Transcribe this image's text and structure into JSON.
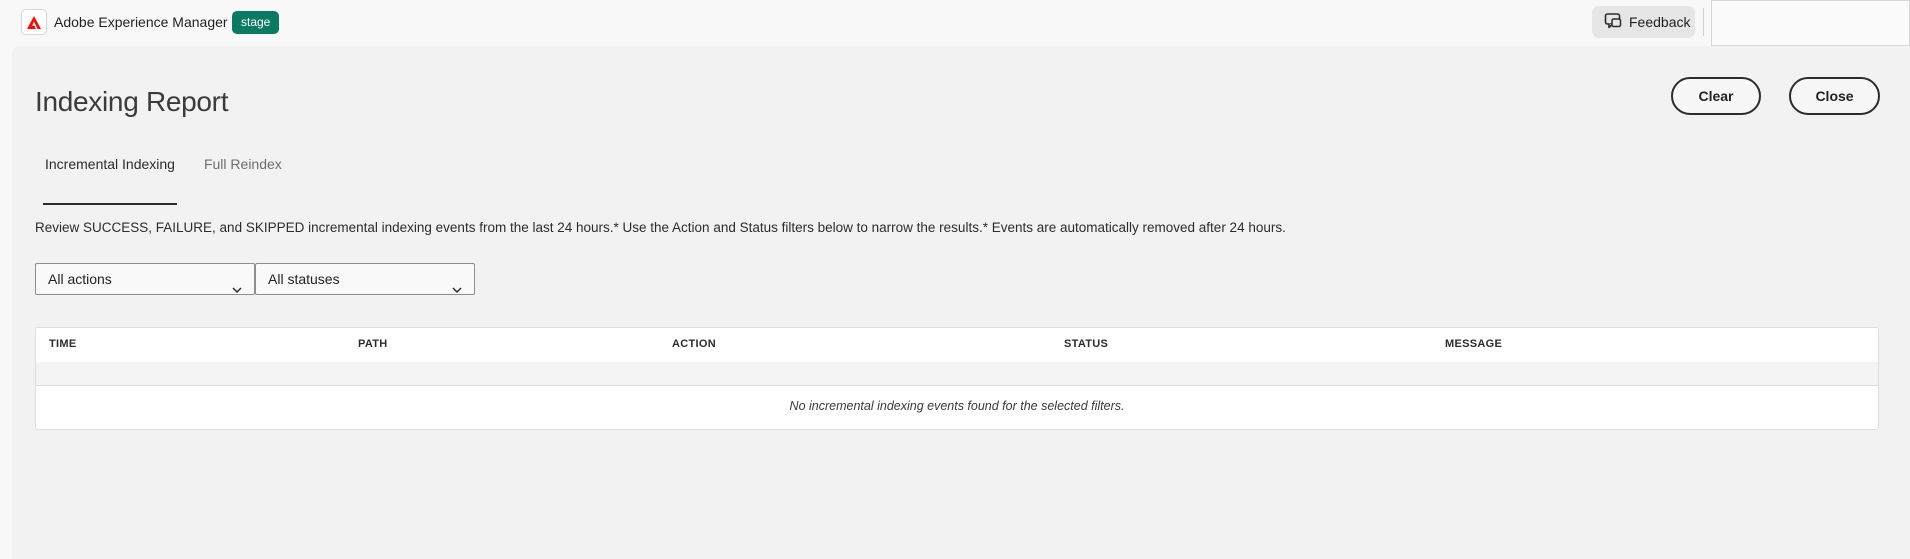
{
  "topbar": {
    "app_name": "Adobe Experience Manager",
    "env_badge": "stage",
    "feedback_label": "Feedback",
    "logo_icon": "adobe-logo-icon",
    "feedback_icon": "chat-bubble-icon",
    "brand_color": "#eb1000",
    "badge_color": "#0b7a63"
  },
  "page": {
    "title": "Indexing Report",
    "clear_label": "Clear",
    "close_label": "Close",
    "description": "Review SUCCESS, FAILURE, and SKIPPED incremental indexing events from the last 24 hours.* Use the Action and Status filters below to narrow the results.* Events are automatically removed after 24 hours."
  },
  "tabs": [
    {
      "label": "Incremental Indexing",
      "active": true
    },
    {
      "label": "Full Reindex",
      "active": false
    }
  ],
  "filters": {
    "action": {
      "selected": "All actions",
      "icon": "chevron-down-icon"
    },
    "status": {
      "selected": "All statuses",
      "icon": "chevron-down-icon"
    }
  },
  "table": {
    "columns": [
      "TIME",
      "PATH",
      "ACTION",
      "STATUS",
      "MESSAGE"
    ],
    "rows": [],
    "empty_message": "No incremental indexing events found for the selected filters."
  }
}
